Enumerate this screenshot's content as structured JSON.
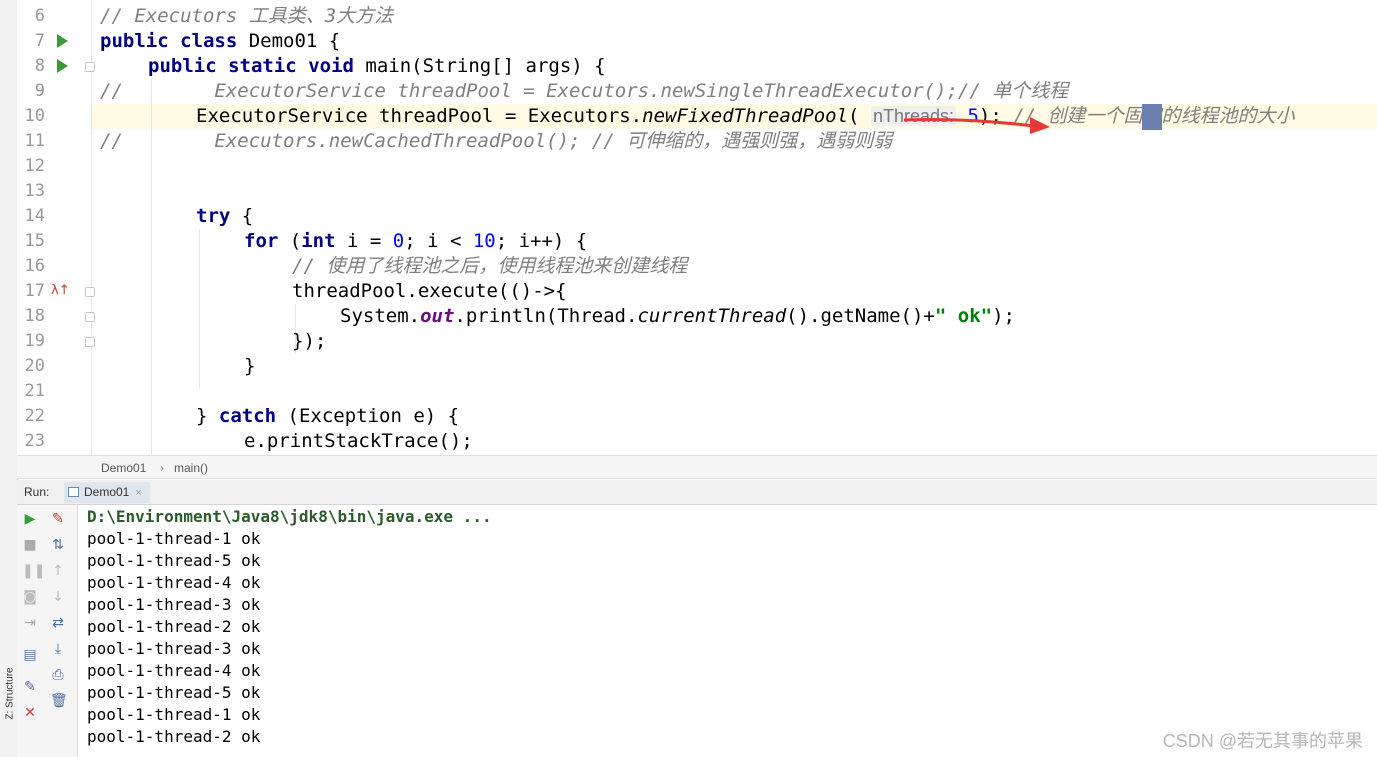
{
  "editor": {
    "lines": [
      {
        "n": "6"
      },
      {
        "n": "7"
      },
      {
        "n": "8"
      },
      {
        "n": "9"
      },
      {
        "n": "10"
      },
      {
        "n": "11"
      },
      {
        "n": "12"
      },
      {
        "n": "13"
      },
      {
        "n": "14"
      },
      {
        "n": "15"
      },
      {
        "n": "16"
      },
      {
        "n": "17"
      },
      {
        "n": "18"
      },
      {
        "n": "19"
      },
      {
        "n": "20"
      },
      {
        "n": "21"
      },
      {
        "n": "22"
      },
      {
        "n": "23"
      }
    ],
    "code": {
      "l6": "// Executors 工具类、3大方法",
      "l7_kw1": "public",
      "l7_kw2": "class",
      "l7_rest": " Demo01 {",
      "l8_kw1": "public",
      "l8_kw2": "static",
      "l8_kw3": "void",
      "l8_rest": " main(String[] args) {",
      "l9": "//        ExecutorService threadPool = Executors.newSingleThreadExecutor();// 单个线程",
      "l10_a": "ExecutorService threadPool = Executors.",
      "l10_method": "newFixedThreadPool",
      "l10_open": "(",
      "l10_hint": "nThreads:",
      "l10_num": "5",
      "l10_close": ");",
      "l10_comment": " // 创建一个固定的线程池的大小",
      "l11": "//        Executors.newCachedThreadPool(); // 可伸缩的，遇强则强，遇弱则弱",
      "l14_kw": "try",
      "l14_rest": " {",
      "l15_kw": "for",
      "l15_a": " (",
      "l15_int": "int",
      "l15_b": " i = ",
      "l15_n0": "0",
      "l15_c": "; i < ",
      "l15_n10": "10",
      "l15_d": "; i++) {",
      "l16": "// 使用了线程池之后，使用线程池来创建线程",
      "l17": "threadPool.execute(()->{",
      "l18_a": "System.",
      "l18_out": "out",
      "l18_b": ".println(Thread.",
      "l18_ct": "currentThread",
      "l18_c": "().getName()+",
      "l18_str": "\" ok\"",
      "l18_d": ");",
      "l19": "});",
      "l20": "}",
      "l22_a": "} ",
      "l22_kw": "catch",
      "l22_b": " (Exception e) {",
      "l23": "e.printStackTrace();"
    }
  },
  "breadcrumb": {
    "class_name": "Demo01",
    "separator": "›",
    "method": "main()"
  },
  "run_panel": {
    "label": "Run:",
    "tab": "Demo01",
    "tab_close": "×",
    "command": "D:\\Environment\\Java8\\jdk8\\bin\\java.exe ...",
    "output": [
      "pool-1-thread-1 ok",
      "pool-1-thread-5 ok",
      "pool-1-thread-4 ok",
      "pool-1-thread-3 ok",
      "pool-1-thread-2 ok",
      "pool-1-thread-3 ok",
      "pool-1-thread-4 ok",
      "pool-1-thread-5 ok",
      "pool-1-thread-1 ok",
      "pool-1-thread-2 ok"
    ]
  },
  "side_tab": {
    "structure": "Z: Structure"
  },
  "watermark": "CSDN @若无其事的苹果",
  "colors": {
    "keyword": "#000080",
    "comment": "#808080",
    "number": "#0000ff",
    "string": "#008000",
    "static_field": "#660e7a",
    "run_green": "#3a9a3a",
    "arrow_red": "#e53935"
  }
}
